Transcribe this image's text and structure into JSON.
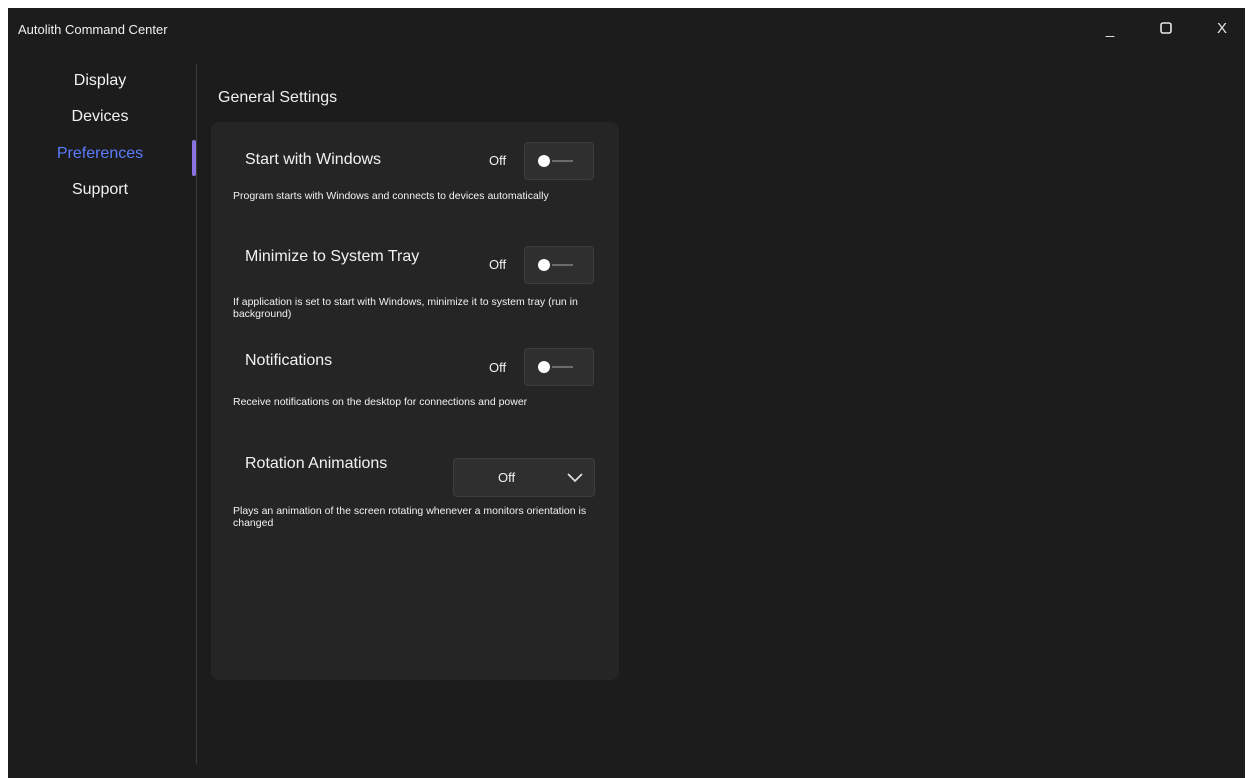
{
  "window": {
    "title": "Autolith Command Center",
    "controls": {
      "minimize": "_",
      "close": "X"
    }
  },
  "sidebar": {
    "items": [
      {
        "label": "Display"
      },
      {
        "label": "Devices"
      },
      {
        "label": "Preferences",
        "active": true
      },
      {
        "label": "Support"
      }
    ]
  },
  "main": {
    "section_title": "General Settings",
    "settings": [
      {
        "name": "Start with Windows",
        "state": "Off",
        "description": "Program starts with Windows and connects to devices automatically"
      },
      {
        "name": "Minimize to System Tray",
        "state": "Off",
        "description": "If application is set to start with Windows, minimize it to system tray (run in background)"
      },
      {
        "name": "Notifications",
        "state": "Off",
        "description": "Receive notifications on the desktop for connections and power"
      },
      {
        "name": "Rotation Animations",
        "value": "Off",
        "description": "Plays an animation of the screen rotating whenever a monitors orientation is changed"
      }
    ]
  },
  "colors": {
    "background": "#1c1c1c",
    "panel": "#252525",
    "accent_text": "#5b7cff",
    "accent_indicator": "#8a72e0"
  },
  "icons": {
    "minimize": "minimize-icon",
    "maximize": "maximize-icon",
    "close": "close-icon",
    "dropdown": "chevron-down-icon"
  }
}
